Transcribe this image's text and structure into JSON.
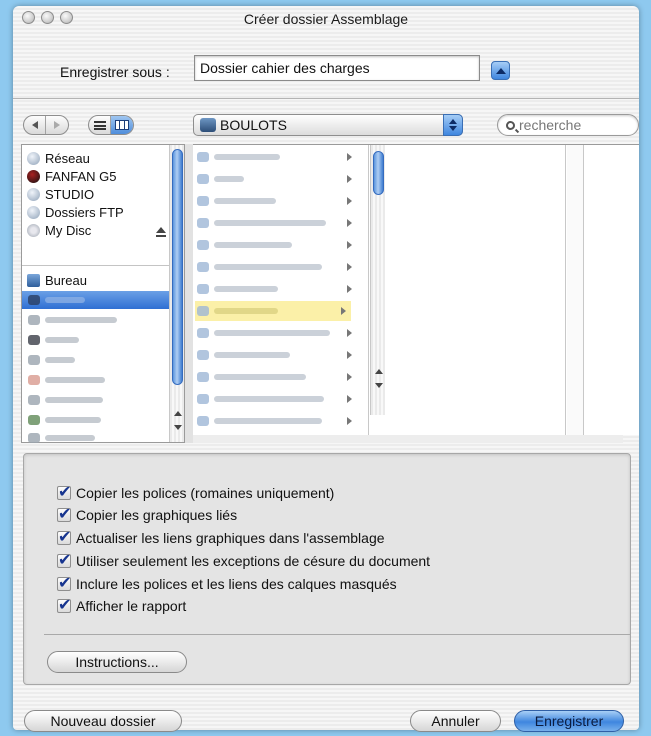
{
  "window": {
    "title": "Créer dossier Assemblage"
  },
  "save": {
    "label": "Enregistrer sous :",
    "value": "Dossier cahier des charges"
  },
  "toolbar": {
    "location": "BOULOTS",
    "search_placeholder": "recherche"
  },
  "sidebar": {
    "items": [
      {
        "label": "Réseau",
        "icon": "network-icon"
      },
      {
        "label": "FANFAN G5",
        "icon": "computer-icon"
      },
      {
        "label": "STUDIO",
        "icon": "network-volume-icon"
      },
      {
        "label": "Dossiers FTP",
        "icon": "network-volume-icon"
      },
      {
        "label": "My Disc",
        "icon": "disc-icon"
      },
      {
        "label": "Bureau",
        "icon": "desktop-icon"
      }
    ]
  },
  "options": {
    "checkboxes": [
      {
        "label": "Copier les polices (romaines uniquement)",
        "checked": true
      },
      {
        "label": "Copier les graphiques liés",
        "checked": true
      },
      {
        "label": "Actualiser les liens graphiques dans l'assemblage",
        "checked": true
      },
      {
        "label": "Utiliser seulement les exceptions de césure du document",
        "checked": true
      },
      {
        "label": "Inclure les polices et les liens des calques masqués",
        "checked": true
      },
      {
        "label": "Afficher le rapport",
        "checked": true
      }
    ],
    "instructions_label": "Instructions..."
  },
  "footer": {
    "new_folder_label": "Nouveau dossier",
    "cancel_label": "Annuler",
    "save_label": "Enregistrer"
  },
  "colors": {
    "accent": "#3f86df",
    "highlight": "#fbf0a8",
    "background": "#8ec9ef"
  }
}
